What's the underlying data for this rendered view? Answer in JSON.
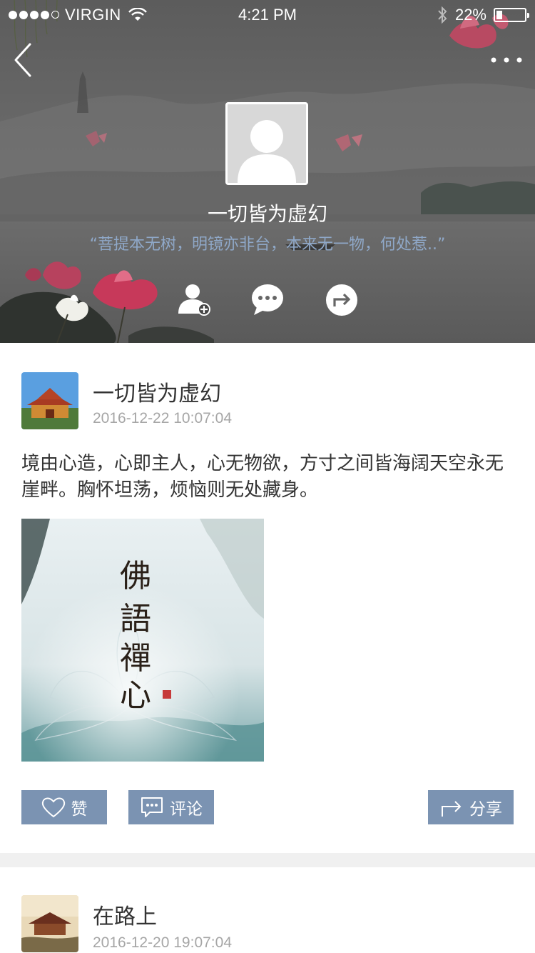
{
  "status_bar": {
    "carrier": "VIRGIN",
    "time": "4:21 PM",
    "battery": "22%",
    "battery_level": 0.22
  },
  "header": {
    "back_icon": "chevron-left-icon",
    "more_icon": "ellipsis-icon",
    "name": "一切皆为虚幻",
    "quote": "“菩提本无树，明镜亦非台，本来无一物，何处惹..”",
    "actions": [
      "add-friend-icon",
      "chat-bubble-icon",
      "share-arrow-icon"
    ]
  },
  "posts": [
    {
      "user": "一切皆为虚幻",
      "date": "2016-12-22 10:07:04",
      "text": "境由心造，心即主人，心无物欲，方寸之间皆海阔天空永无崖畔。胸怀坦荡，烦恼则无处藏身。",
      "image_caption": "佛語禪心",
      "like_label": "赞",
      "comment_label": "评论",
      "share_label": "分享"
    },
    {
      "user": "在路上",
      "date": "2016-12-20 19:07:04"
    }
  ],
  "colors": {
    "action_button": "#7b93b2",
    "quote_text": "#8fa8c8",
    "date_text": "#a6a6a6"
  }
}
